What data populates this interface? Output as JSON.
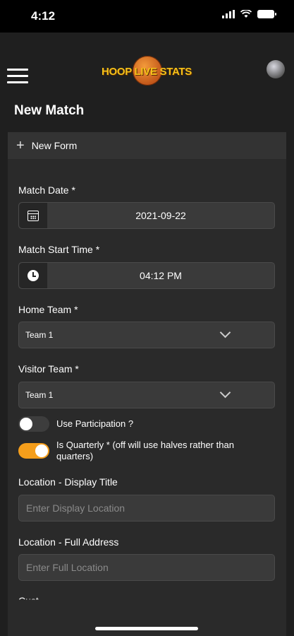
{
  "status_bar": {
    "time": "4:12"
  },
  "header": {
    "logo_text": "HOOP LIVE STATS"
  },
  "page": {
    "title": "New Match"
  },
  "form": {
    "header_label": "New Form",
    "match_date": {
      "label": "Match Date *",
      "value": "2021-09-22"
    },
    "match_start_time": {
      "label": "Match Start Time *",
      "value": "04:12 PM"
    },
    "home_team": {
      "label": "Home Team *",
      "selected": "Team 1"
    },
    "visitor_team": {
      "label": "Visitor Team *",
      "selected": "Team 1"
    },
    "use_participation": {
      "label": "Use Participation ?",
      "on": false
    },
    "is_quarterly": {
      "label": "Is Quarterly * (off will use halves rather than quarters)",
      "on": true
    },
    "location_display": {
      "label": "Location - Display Title",
      "placeholder": "Enter Display Location"
    },
    "location_full": {
      "label": "Location - Full Address",
      "placeholder": "Enter Full Location"
    },
    "next_label_partial": "Cust"
  },
  "colors": {
    "accent": "#f59e1b",
    "background": "#1f1f1f",
    "card": "#2a2a2a"
  }
}
